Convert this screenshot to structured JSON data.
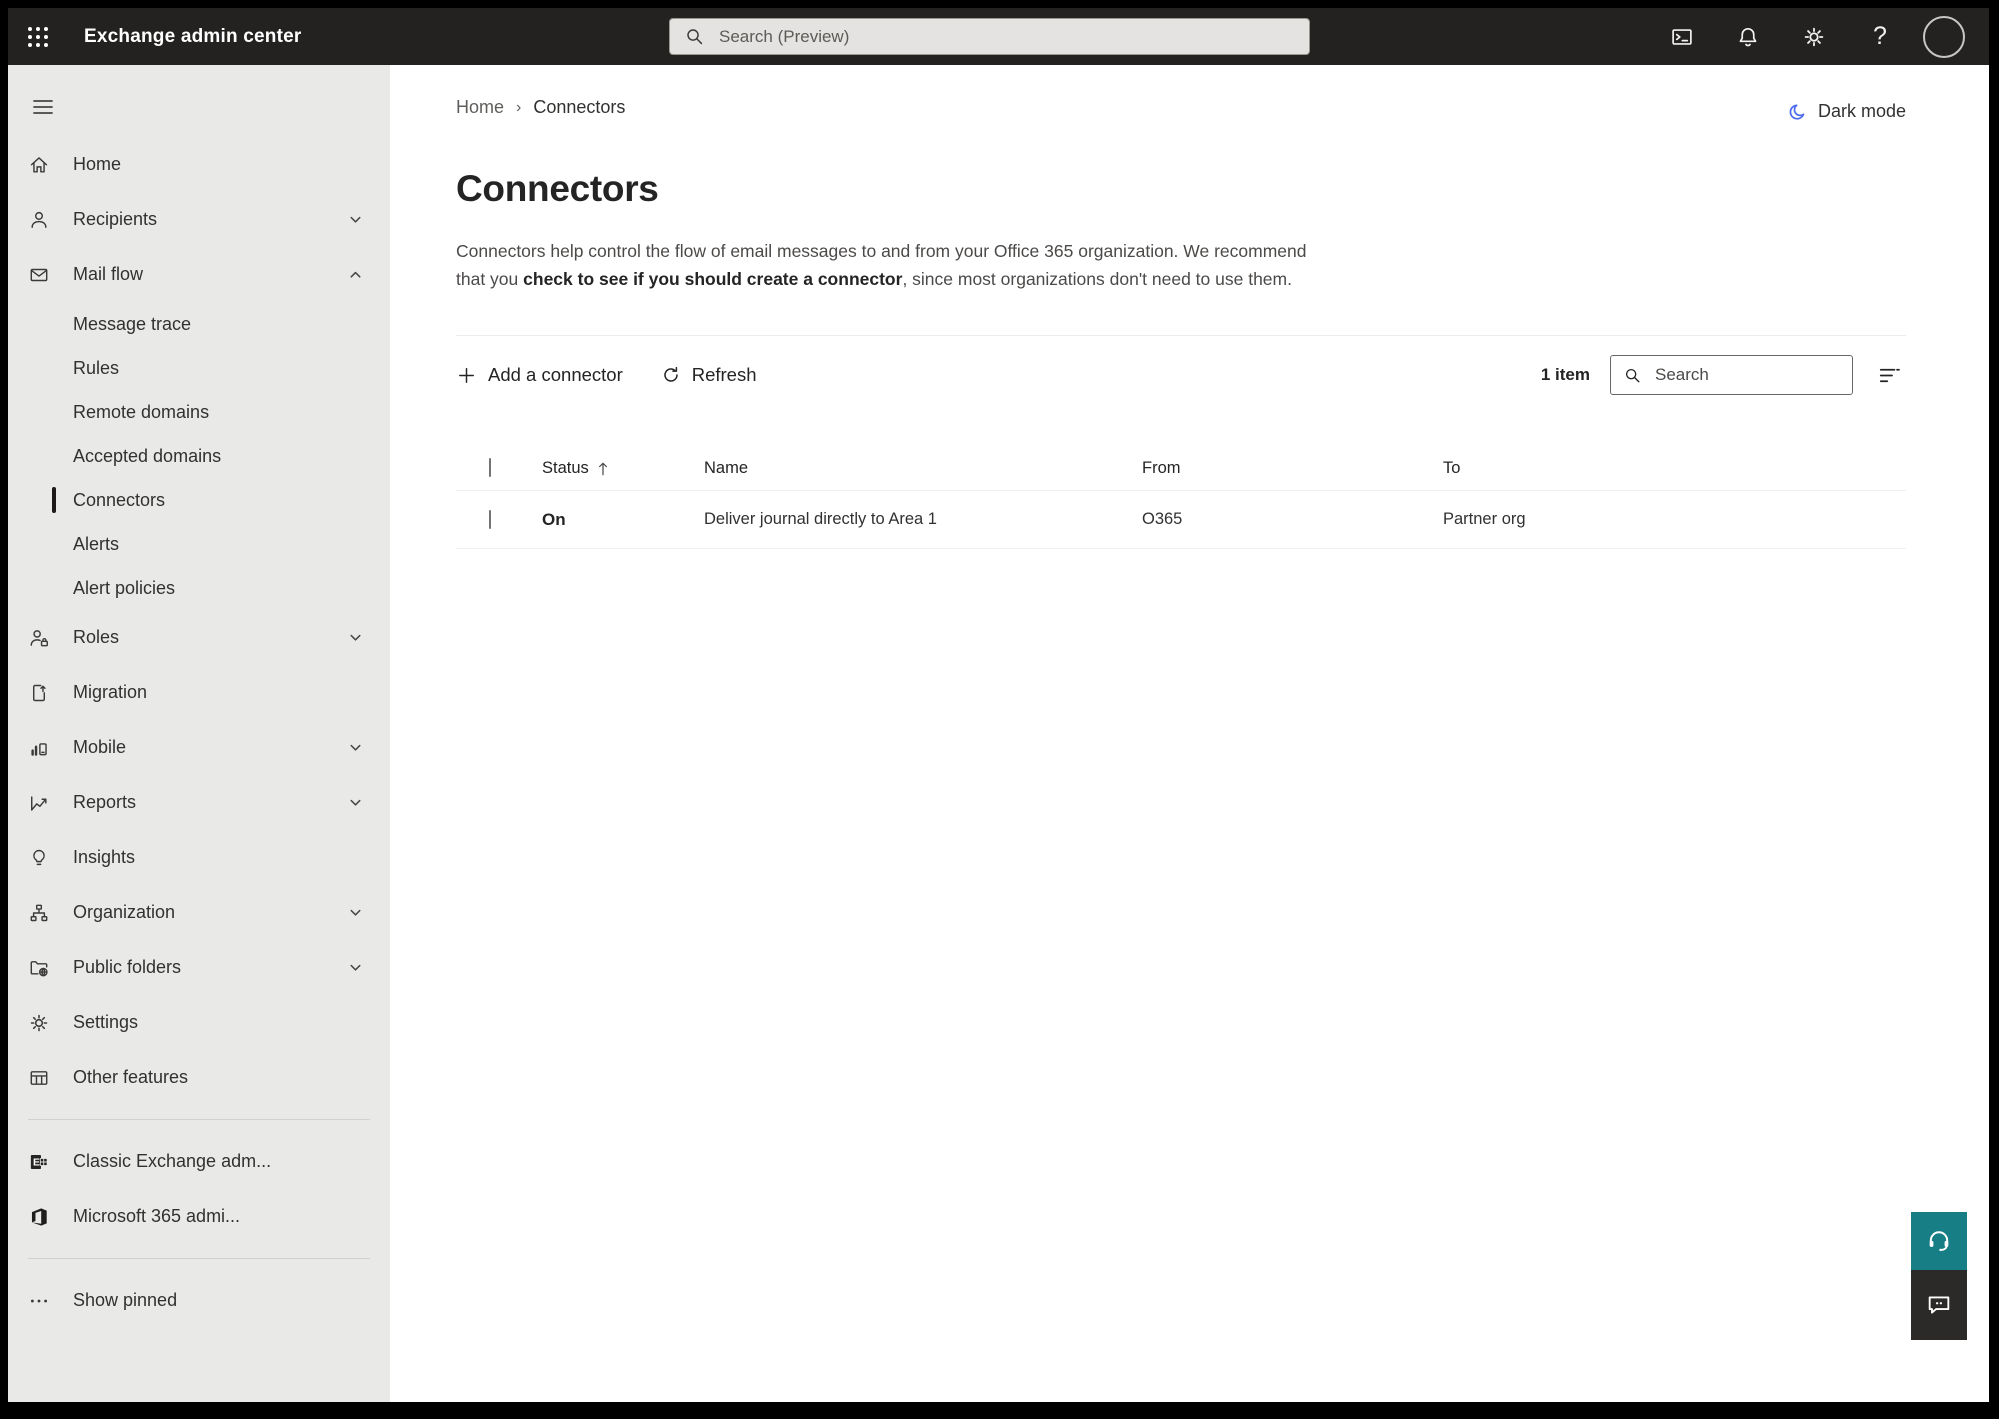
{
  "topbar": {
    "title": "Exchange admin center",
    "search_placeholder": "Search (Preview)"
  },
  "icons": {
    "app-launcher": "3x3 dot grid",
    "powershell": "terminal window",
    "notifications": "bell",
    "settings": "gear",
    "help": "?",
    "dark-mode": "crescent moon",
    "add": "plus",
    "refresh": "circular arrow",
    "sort-ascending": "up arrow",
    "filter": "three shrinking lines",
    "search": "magnifier",
    "support": "headset",
    "feedback": "speech bubble"
  },
  "colors": {
    "topbar_bg": "#232221",
    "sidebar_bg": "#e9e9e8",
    "moon_blue": "#4f6bed",
    "support_teal": "#187e86",
    "feedback_dark": "#2b2a29"
  },
  "sidebar": {
    "items": [
      {
        "label": "Home"
      },
      {
        "label": "Recipients"
      },
      {
        "label": "Mail flow"
      },
      {
        "label": "Message trace"
      },
      {
        "label": "Rules"
      },
      {
        "label": "Remote domains"
      },
      {
        "label": "Accepted domains"
      },
      {
        "label": "Connectors",
        "selected": true
      },
      {
        "label": "Alerts"
      },
      {
        "label": "Alert policies"
      },
      {
        "label": "Roles"
      },
      {
        "label": "Migration"
      },
      {
        "label": "Mobile"
      },
      {
        "label": "Reports"
      },
      {
        "label": "Insights"
      },
      {
        "label": "Organization"
      },
      {
        "label": "Public folders"
      },
      {
        "label": "Settings"
      },
      {
        "label": "Other features"
      },
      {
        "label": "Classic Exchange adm..."
      },
      {
        "label": "Microsoft 365 admi..."
      },
      {
        "label": "Show pinned"
      }
    ]
  },
  "breadcrumb": {
    "home": "Home",
    "current": "Connectors"
  },
  "header_actions": {
    "dark_mode": "Dark mode"
  },
  "page": {
    "title": "Connectors",
    "desc_before": "Connectors help control the flow of email messages to and from your Office 365 organization. We recommend that you ",
    "desc_link": "check to see if you should create a connector",
    "desc_after": ", since most organizations don't need to use them."
  },
  "toolbar": {
    "add": "Add a connector",
    "refresh": "Refresh",
    "count": "1 item",
    "search_placeholder": "Search"
  },
  "table": {
    "headers": {
      "status": "Status",
      "name": "Name",
      "from": "From",
      "to": "To"
    },
    "rows": [
      {
        "status": "On",
        "name": "Deliver journal directly to Area 1",
        "from": "O365",
        "to": "Partner org"
      }
    ]
  }
}
